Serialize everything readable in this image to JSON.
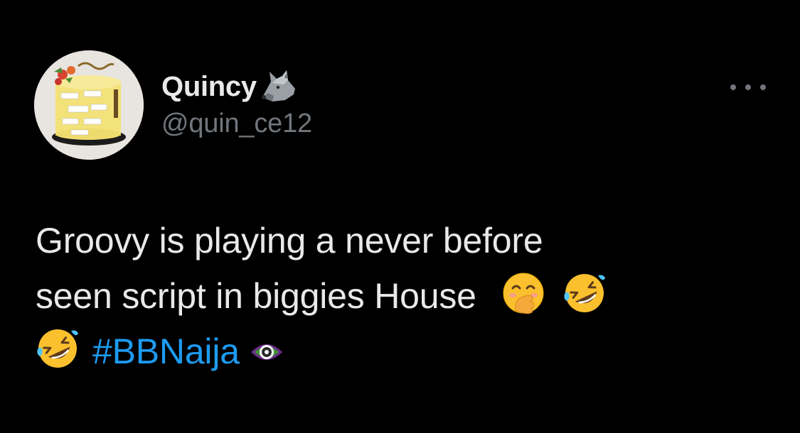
{
  "author": {
    "display_name": "Quincy",
    "name_emoji": "wolf-face",
    "handle": "@quin_ce12",
    "avatar_caption": "Happy Birthday",
    "avatar_cake_labels": [
      "Dearest",
      "Happy"
    ]
  },
  "more_menu": {
    "icon": "more-horizontal-icon"
  },
  "tweet": {
    "text_line1": "Groovy is playing a never before",
    "text_line2": "seen script in biggies House",
    "emoji_after_text": [
      "face-with-hand-over-mouth",
      "rolling-on-the-floor-laughing"
    ],
    "emoji_line3": "rolling-on-the-floor-laughing",
    "hashtag": "#BBNaija",
    "hashflag_icon": "eye-icon"
  },
  "colors": {
    "background": "#000000",
    "text_primary": "#e7e9ea",
    "text_secondary": "#71767b",
    "link": "#1d9bf0"
  }
}
